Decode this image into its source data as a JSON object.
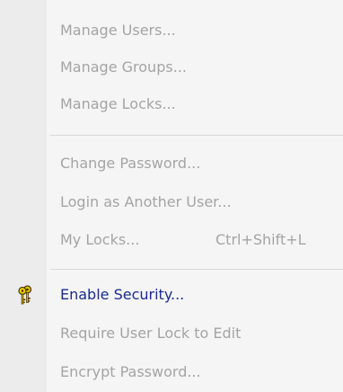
{
  "menu": {
    "items": [
      {
        "label": "Manage Users...",
        "enabled": false
      },
      {
        "label": "Manage Groups...",
        "enabled": false
      },
      {
        "label": "Manage Locks...",
        "enabled": false
      },
      {
        "label": "Change Password...",
        "enabled": false
      },
      {
        "label": "Login as Another User...",
        "enabled": false
      },
      {
        "label": "My Locks...",
        "shortcut": "Ctrl+Shift+L",
        "enabled": false
      },
      {
        "label": "Enable Security...",
        "enabled": true,
        "icon": "keys-icon"
      },
      {
        "label": "Require User Lock to Edit",
        "enabled": false
      },
      {
        "label": "Encrypt Password...",
        "enabled": false
      }
    ]
  },
  "colors": {
    "enabled_text": "#1b2c8a",
    "disabled_text": "#a4a4a4",
    "menu_background": "#f5f5f5",
    "icon_gutter": "#ececec",
    "key_gold": "#d8b400"
  }
}
